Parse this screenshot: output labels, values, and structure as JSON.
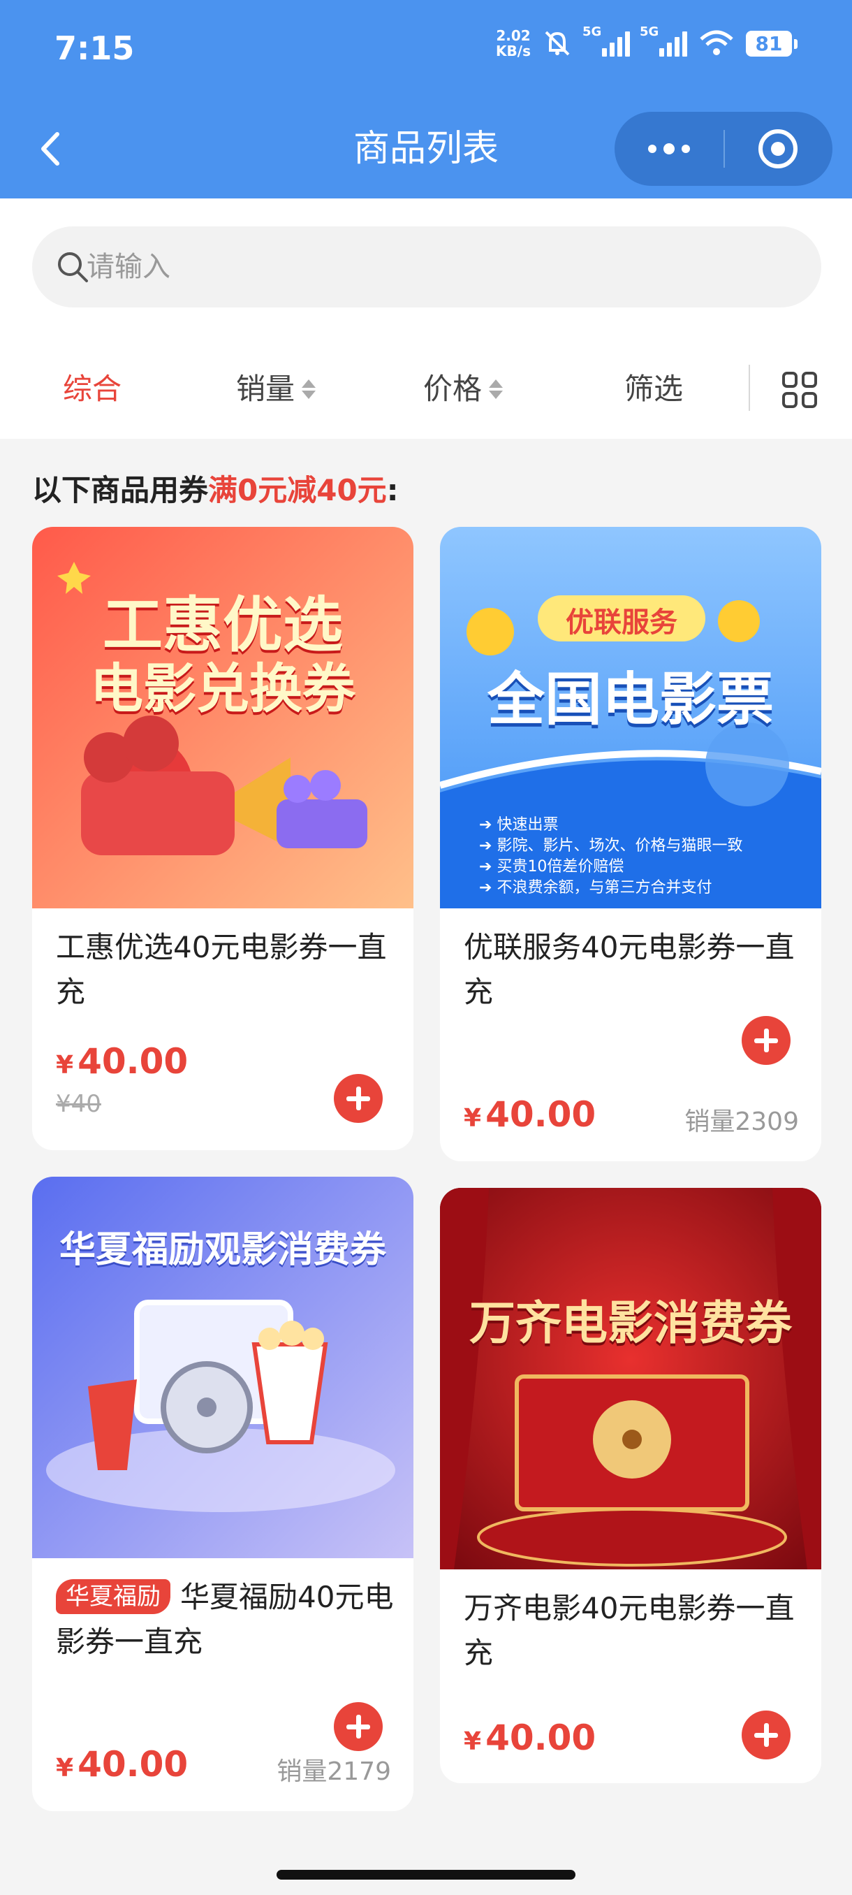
{
  "status_bar": {
    "time": "7:15",
    "net_speed": "2.02",
    "net_unit": "KB/s",
    "sim1": "5G",
    "sim2": "5G",
    "battery": "81"
  },
  "nav": {
    "title": "商品列表"
  },
  "search": {
    "placeholder": "请输入"
  },
  "tabs": [
    {
      "label": "综合",
      "active": true
    },
    {
      "label": "销量"
    },
    {
      "label": "价格"
    },
    {
      "label": "筛选"
    }
  ],
  "coupon": {
    "prefix": "以下商品用券",
    "highlight": "满0元减40元",
    "suffix": ":"
  },
  "products": [
    {
      "name": "工惠优选40元电影券一直充",
      "price": "40.00",
      "original_price": "¥40",
      "image": {
        "line1": "工惠优选",
        "line2": "电影兑换券",
        "colors": [
          "#ff5a4a",
          "#ffb07a"
        ]
      }
    },
    {
      "name": "优联服务40元电影券一直充",
      "price": "40.00",
      "sales": "销量2309",
      "image": {
        "badge": "优联服务",
        "title": "全国电影票",
        "bullets": [
          "快速出票",
          "影院、影片、场次、价格与猫眼一致",
          "买贵10倍差价赔偿",
          "不浪费余额，与第三方合并支付"
        ],
        "colors": [
          "#3d8ff5",
          "#8fc6ff"
        ]
      }
    },
    {
      "tag": "华夏福励",
      "name": "华夏福励40元电影券一直充",
      "price": "40.00",
      "sales": "销量2179",
      "image": {
        "title": "华夏福励观影消费券",
        "colors": [
          "#5a6ef0",
          "#b7b5f7"
        ]
      }
    },
    {
      "name": "万齐电影40元电影券一直充",
      "price": "40.00",
      "image": {
        "title": "万齐电影消费券",
        "colors": [
          "#b3121a",
          "#e8302e"
        ]
      }
    }
  ],
  "currency": "¥"
}
